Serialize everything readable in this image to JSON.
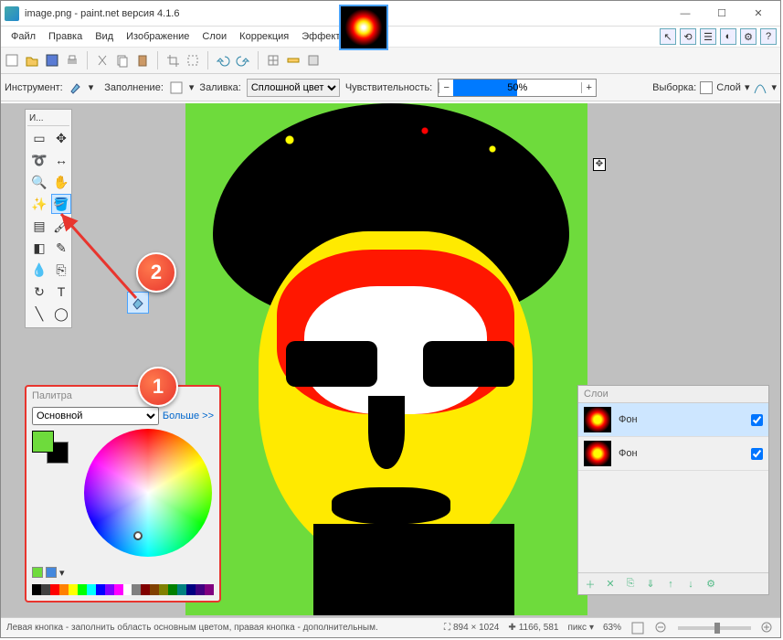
{
  "title": "image.png - paint.net версия 4.1.6",
  "window_buttons": {
    "min": "—",
    "max": "☐",
    "close": "✕"
  },
  "menu": [
    "Файл",
    "Правка",
    "Вид",
    "Изображение",
    "Слои",
    "Коррекция",
    "Эффекты"
  ],
  "top_right_icons": [
    "tool-icon",
    "history-icon",
    "layers-icon",
    "colors-icon",
    "settings-icon",
    "help-icon"
  ],
  "toolbar2": {
    "tool_label": "Инструмент:",
    "fill_label": "Заполнение:",
    "flood_label": "Заливка:",
    "flood_mode": "Сплошной цвет",
    "sensitivity_label": "Чувствительность:",
    "sensitivity_value": "50%",
    "selection_label": "Выборка:",
    "layer_label": "Слой"
  },
  "tools": {
    "title": "И...",
    "items": [
      "rect-select-icon",
      "move-icon",
      "lasso-icon",
      "move-sel-icon",
      "zoom-icon",
      "pan-icon",
      "wand-icon",
      "bucket-icon",
      "gradient-icon",
      "brush-icon",
      "eraser-icon",
      "pencil-icon",
      "picker-icon",
      "clone-icon",
      "recolor-icon",
      "text-icon",
      "line-icon",
      "shapes-icon"
    ],
    "selected_index": 7
  },
  "colors": {
    "title": "Палитра",
    "mode_options": [
      "Основной"
    ],
    "mode": "Основной",
    "more": "Больше >>",
    "fg": "#6edb3c",
    "bg": "#000000",
    "palette": [
      "#000",
      "#404040",
      "#ff0000",
      "#ff8000",
      "#ffff00",
      "#00ff00",
      "#00ffff",
      "#0000ff",
      "#8000ff",
      "#ff00ff",
      "#fff",
      "#808080",
      "#800000",
      "#804000",
      "#808000",
      "#008000",
      "#008080",
      "#000080",
      "#400080",
      "#800080"
    ]
  },
  "layers": {
    "title": "Слои",
    "items": [
      {
        "name": "Фон",
        "visible": true,
        "selected": true
      },
      {
        "name": "Фон",
        "visible": true,
        "selected": false
      }
    ],
    "buttons": [
      "add-layer-icon",
      "delete-layer-icon",
      "duplicate-layer-icon",
      "merge-down-icon",
      "move-up-icon",
      "move-down-icon",
      "properties-icon"
    ]
  },
  "status": {
    "hint": "Левая кнопка - заполнить область основным цветом, правая кнопка - дополнительным.",
    "size_icon": "⛶",
    "size": "894 × 1024",
    "pos_icon": "✚",
    "pos": "1166, 581",
    "unit": "пикс",
    "zoom": "63%"
  },
  "annotations": {
    "one": "1",
    "two": "2"
  }
}
